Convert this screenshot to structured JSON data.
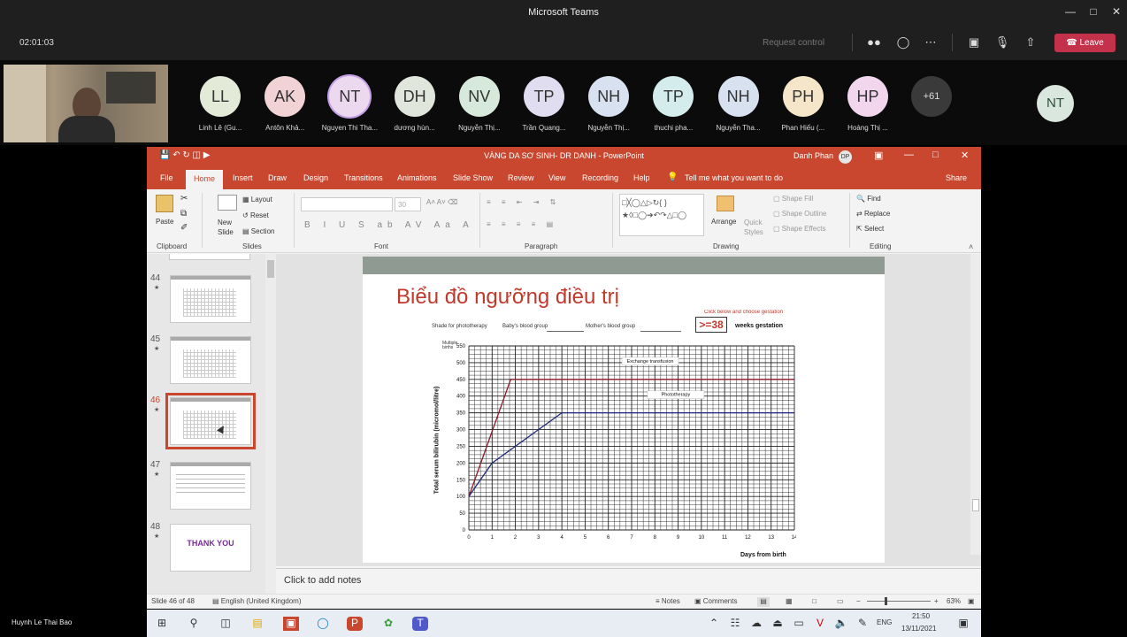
{
  "teams": {
    "title": "Microsoft Teams",
    "timer": "02:01:03",
    "request_control": "Request control",
    "leave": "Leave",
    "more_count": "+61",
    "presenter": "Huynh Le Thai Bao",
    "participants": [
      {
        "initials": "LL",
        "name": "Linh Lê (Gu...",
        "color": "#e4ead8"
      },
      {
        "initials": "AK",
        "name": "Antôn Khả...",
        "color": "#f1d3d5"
      },
      {
        "initials": "NT",
        "name": "Nguyen Thi Tha...",
        "color": "#ecd9f0"
      },
      {
        "initials": "DH",
        "name": "dương hùn...",
        "color": "#e0e6dc"
      },
      {
        "initials": "NV",
        "name": "Nguyễn Thị...",
        "color": "#d6e9da"
      },
      {
        "initials": "TP",
        "name": "Trần Quang...",
        "color": "#e1ddf0"
      },
      {
        "initials": "NH",
        "name": "Nguyễn Thị...",
        "color": "#d8e1f0"
      },
      {
        "initials": "TP",
        "name": "thuchi pha...",
        "color": "#d5ecec"
      },
      {
        "initials": "NH",
        "name": "Nguyễn Tha...",
        "color": "#d8e1f0"
      },
      {
        "initials": "PH",
        "name": "Phan Hiếu (...",
        "color": "#f5e6c9"
      },
      {
        "initials": "HP",
        "name": "Hoàng Thị ...",
        "color": "#f1d6ee"
      }
    ],
    "right_initials": "NT"
  },
  "ppt": {
    "title": "VÀNG DA SƠ SINH- DR DANH  -  PowerPoint",
    "user": "Danh Phan",
    "user_initials": "DP",
    "share": "Share",
    "tabs": [
      "File",
      "Home",
      "Insert",
      "Draw",
      "Design",
      "Transitions",
      "Animations",
      "Slide Show",
      "Review",
      "View",
      "Recording",
      "Help"
    ],
    "tell_me": "Tell me what you want to do",
    "ribbon": {
      "paste": "Paste",
      "new_slide": "New Slide",
      "layout": "Layout",
      "reset": "Reset",
      "section": "Section",
      "font_size": "30",
      "arrange": "Arrange",
      "quick_styles": "Quick Styles",
      "shape_fill": "Shape Fill",
      "shape_outline": "Shape Outline",
      "shape_effects": "Shape Effects",
      "find": "Find",
      "replace": "Replace",
      "select": "Select",
      "groups": [
        "Clipboard",
        "Slides",
        "Font",
        "Paragraph",
        "Drawing",
        "Editing"
      ]
    },
    "slides": [
      {
        "num": "44"
      },
      {
        "num": "45"
      },
      {
        "num": "46"
      },
      {
        "num": "47"
      },
      {
        "num": "48",
        "text": "THANK YOU"
      }
    ],
    "slide": {
      "title": "Biểu đồ ngưỡng điều trị",
      "shade": "Shade for phototherapy",
      "baby_blood": "Baby's blood group",
      "mother_blood": "Mother's blood group",
      "click_below": "Click below and choose gestation",
      "gestation_value": ">=38",
      "weeks": "weeks gestation",
      "multiple_births": "Multiple births",
      "y_label": "Total serum bilirubin (micromol/litre)",
      "x_label": "Days from birth",
      "exchange": "Exchange transfusion",
      "phototherapy": "Phototherapy"
    },
    "notes": "Click to add notes",
    "status": {
      "slide": "Slide 46 of 48",
      "language": "English (United Kingdom)",
      "notes": "Notes",
      "comments": "Comments",
      "zoom": "63%"
    },
    "taskbar": {
      "time": "21:50",
      "date": "13/11/2021",
      "lang": "ENG"
    }
  },
  "chart_data": {
    "type": "line",
    "xlabel": "Days from birth",
    "ylabel": "Total serum bilirubin (micromol/litre)",
    "xlim": [
      0,
      14
    ],
    "ylim": [
      0,
      550
    ],
    "x_ticks": [
      0,
      1,
      2,
      3,
      4,
      5,
      6,
      7,
      8,
      9,
      10,
      11,
      12,
      13,
      14
    ],
    "y_ticks": [
      0,
      50,
      100,
      150,
      200,
      250,
      300,
      350,
      400,
      450,
      500,
      550
    ],
    "series": [
      {
        "name": "Exchange transfusion",
        "color": "#8b1a2a",
        "x": [
          0,
          1.8,
          14
        ],
        "y": [
          100,
          450,
          450
        ]
      },
      {
        "name": "Phototherapy",
        "color": "#1f2a7a",
        "x": [
          0,
          1,
          4,
          14
        ],
        "y": [
          100,
          200,
          350,
          350
        ]
      }
    ]
  }
}
